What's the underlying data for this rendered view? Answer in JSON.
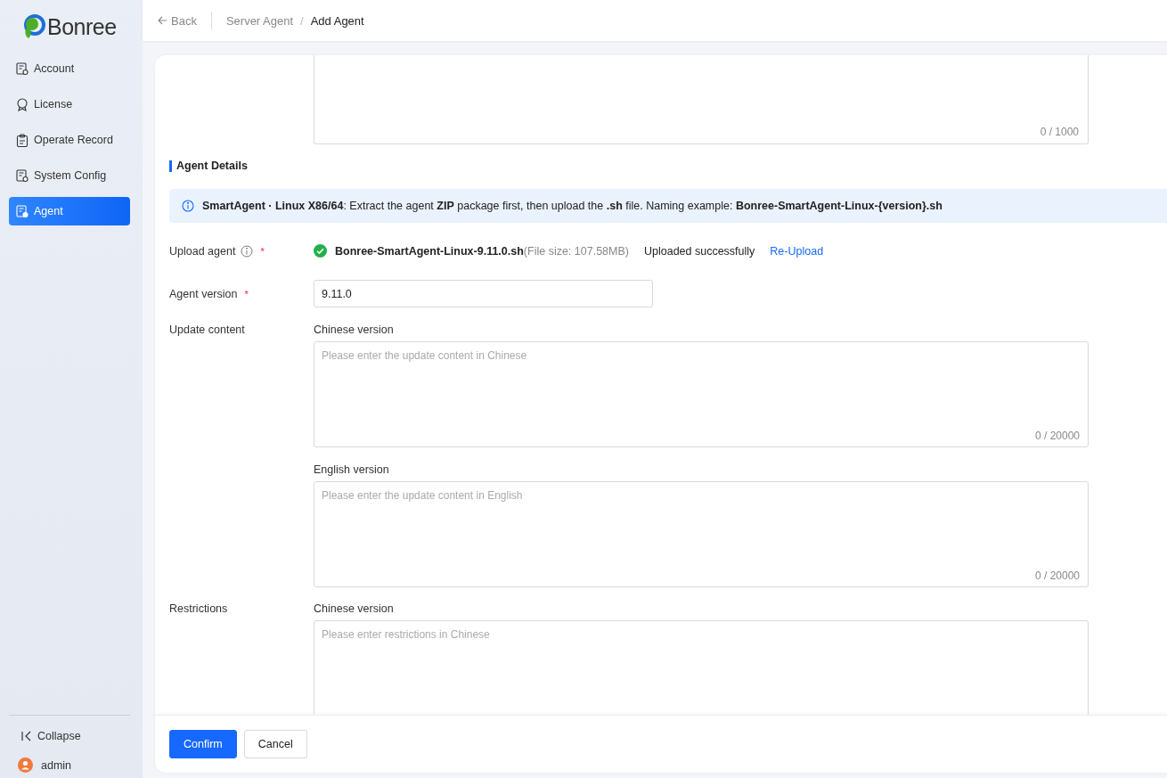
{
  "sidebar": {
    "logo": "Bonree",
    "items": [
      {
        "label": "Account",
        "selected": false
      },
      {
        "label": "License",
        "selected": false
      },
      {
        "label": "Operate Record",
        "selected": false
      },
      {
        "label": "System Config",
        "selected": false
      },
      {
        "label": "Agent",
        "selected": true
      }
    ],
    "collapse": "Collapse",
    "user": "admin"
  },
  "header": {
    "back": "Back",
    "breadcrumb": [
      "Server Agent",
      "Add Agent"
    ],
    "separator": "/"
  },
  "form": {
    "top_textarea": {
      "counter": "0 / 1000"
    },
    "section_title": "Agent Details",
    "alert": "**SmartAgent · Linux X86/64**: Extract the agent **ZIP** package first, then upload the **.sh** file. Naming example: **Bonree-SmartAgent-Linux-{version}.sh**",
    "upload": {
      "label": "Upload agent",
      "required_mark": "*",
      "file_name": "Bonree-SmartAgent-Linux-9.11.0.sh",
      "file_size": "(File size: 107.58MB)",
      "status": "Uploaded successfully",
      "action": "Re-Upload"
    },
    "version": {
      "label": "Agent version",
      "required_mark": "*",
      "value": "9.11.0"
    },
    "update_content": {
      "label": "Update content",
      "fields": [
        {
          "label": "Chinese version",
          "placeholder": "Please enter the update content in Chinese",
          "counter": "0 / 20000"
        },
        {
          "label": "English version",
          "placeholder": "Please enter the update content in English",
          "counter": "0 / 20000"
        }
      ]
    },
    "restrictions": {
      "label": "Restrictions",
      "fields": [
        {
          "label": "Chinese version",
          "placeholder": "Please enter restrictions in Chinese"
        }
      ]
    }
  },
  "footer": {
    "buttons": [
      {
        "label": "Confirm",
        "kind": "primary"
      },
      {
        "label": "Cancel",
        "kind": "default"
      }
    ]
  }
}
